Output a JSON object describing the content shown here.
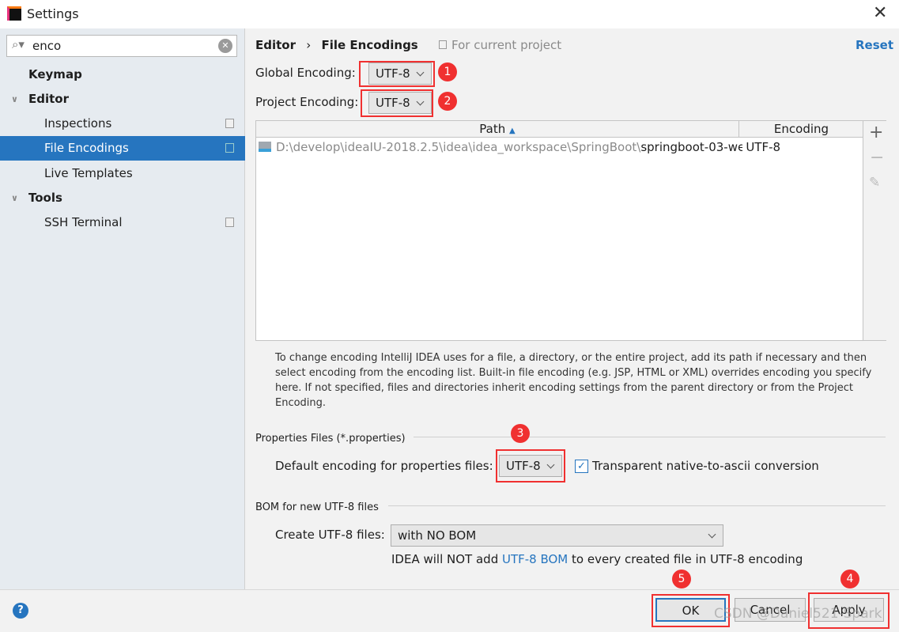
{
  "window": {
    "title": "Settings"
  },
  "search": {
    "value": "enco"
  },
  "sidebar": {
    "items": [
      {
        "label": "Keymap",
        "bold": true
      },
      {
        "label": "Editor",
        "bold": true
      },
      {
        "label": "Inspections"
      },
      {
        "label": "File Encodings",
        "selected": true
      },
      {
        "label": "Live Templates"
      },
      {
        "label": "Tools",
        "bold": true
      },
      {
        "label": "SSH Terminal"
      }
    ]
  },
  "header": {
    "crumb1": "Editor",
    "crumb2": "File Encodings",
    "scope": "For current project",
    "reset": "Reset"
  },
  "global": {
    "label": "Global Encoding:",
    "value": "UTF-8",
    "badge": "1"
  },
  "project": {
    "label": "Project Encoding:",
    "value": "UTF-8",
    "badge": "2"
  },
  "table": {
    "col_path": "Path",
    "col_enc": "Encoding",
    "rows": [
      {
        "path_dim": "D:\\develop\\ideaIU-2018.2.5\\idea\\idea_workspace\\SpringBoot\\",
        "path_name": "springboot-03-we",
        "encoding": "UTF-8"
      }
    ]
  },
  "help": "To change encoding IntelliJ IDEA uses for a file, a directory, or the entire project, add its path if necessary and then select encoding from the encoding list. Built-in file encoding (e.g. JSP, HTML or XML) overrides encoding you specify here. If not specified, files and directories inherit encoding settings from the parent directory or from the Project Encoding.",
  "props": {
    "section": "Properties Files (*.properties)",
    "label": "Default encoding for properties files:",
    "value": "UTF-8",
    "badge": "3",
    "checkbox_label": "Transparent native-to-ascii conversion",
    "checked": true
  },
  "bom": {
    "section": "BOM for new UTF-8 files",
    "label": "Create UTF-8 files:",
    "value": "with NO BOM",
    "note_pre": "IDEA will NOT add ",
    "note_link": "UTF-8 BOM",
    "note_post": " to every created file in UTF-8 encoding"
  },
  "buttons": {
    "ok": "OK",
    "cancel": "Cancel",
    "apply": "Apply",
    "ok_badge": "5",
    "apply_badge": "4"
  },
  "watermark": "CSDN @Daniel521-Spark",
  "colors": {
    "accent": "#2675bf",
    "annotation": "#f03030"
  }
}
